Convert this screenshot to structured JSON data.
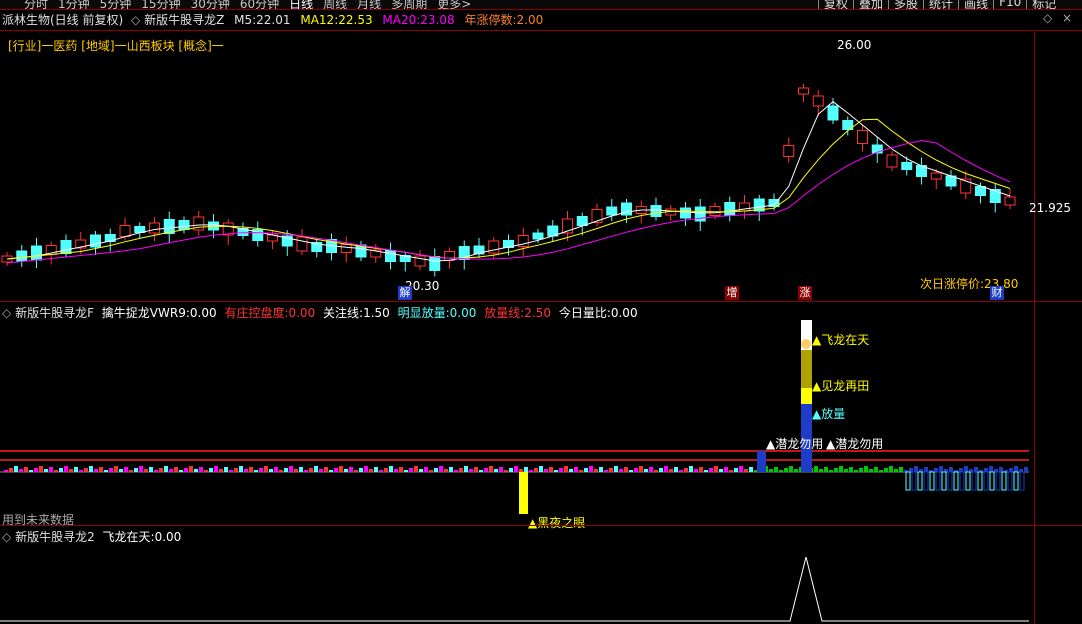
{
  "toolbar": {
    "period_tabs": [
      "分时",
      "1分钟",
      "5分钟",
      "15分钟",
      "30分钟",
      "60分钟",
      "日线",
      "周线",
      "月线",
      "多周期",
      "更多>"
    ],
    "active_tab": "日线",
    "actions": [
      "复权",
      "叠加",
      "多股",
      "统计",
      "画线",
      "F10",
      "标记"
    ]
  },
  "header": {
    "title": "派林生物(日线 前复权)",
    "indicator": "新版牛股寻龙Z",
    "ma5_label": "M5:",
    "ma5": "22.01",
    "ma12_label": "MA12:",
    "ma12": "22.53",
    "ma20_label": "MA20:",
    "ma20": "23.08",
    "limit_label": "年涨停数:",
    "limit": "2.00"
  },
  "tags": {
    "industry": "[行业]一医药",
    "region": "[地域]一山西板块",
    "concept": "[概念]一"
  },
  "price_labels": {
    "high": "26.00",
    "low": "20.30",
    "last": "21.925",
    "next_limit_label": "次日涨停价:",
    "next_limit": "23.80"
  },
  "event_markers": [
    "解",
    "增",
    "涨",
    "财"
  ],
  "panel2": {
    "title": "新版牛股寻龙F",
    "vwr_label": "擒牛捉龙VWR9:",
    "vwr": "0.00",
    "control_label": "有庄控盘度:",
    "control": "0.00",
    "watch_label": "关注线:",
    "watch": "1.50",
    "vol_label": "明显放量:",
    "vol": "0.00",
    "volline_label": "放量线:",
    "volline": "2.50",
    "ratio_label": "今日量比:",
    "ratio": "0.00",
    "future_note": "用到未来数据",
    "signals": {
      "s1": "飞龙在天",
      "s2": "见龙再田",
      "s3": "放量",
      "s4": "潜龙勿用",
      "s5": "潜龙勿用",
      "s6": "黑夜之眼"
    }
  },
  "panel3": {
    "title": "新版牛股寻龙2",
    "label": "飞龙在天:",
    "value": "0.00"
  },
  "colors": {
    "up": "#ff3232",
    "down": "#54ffff",
    "ma5": "#ffffff",
    "ma12": "#ffff00",
    "ma20": "#ff00ff"
  }
}
